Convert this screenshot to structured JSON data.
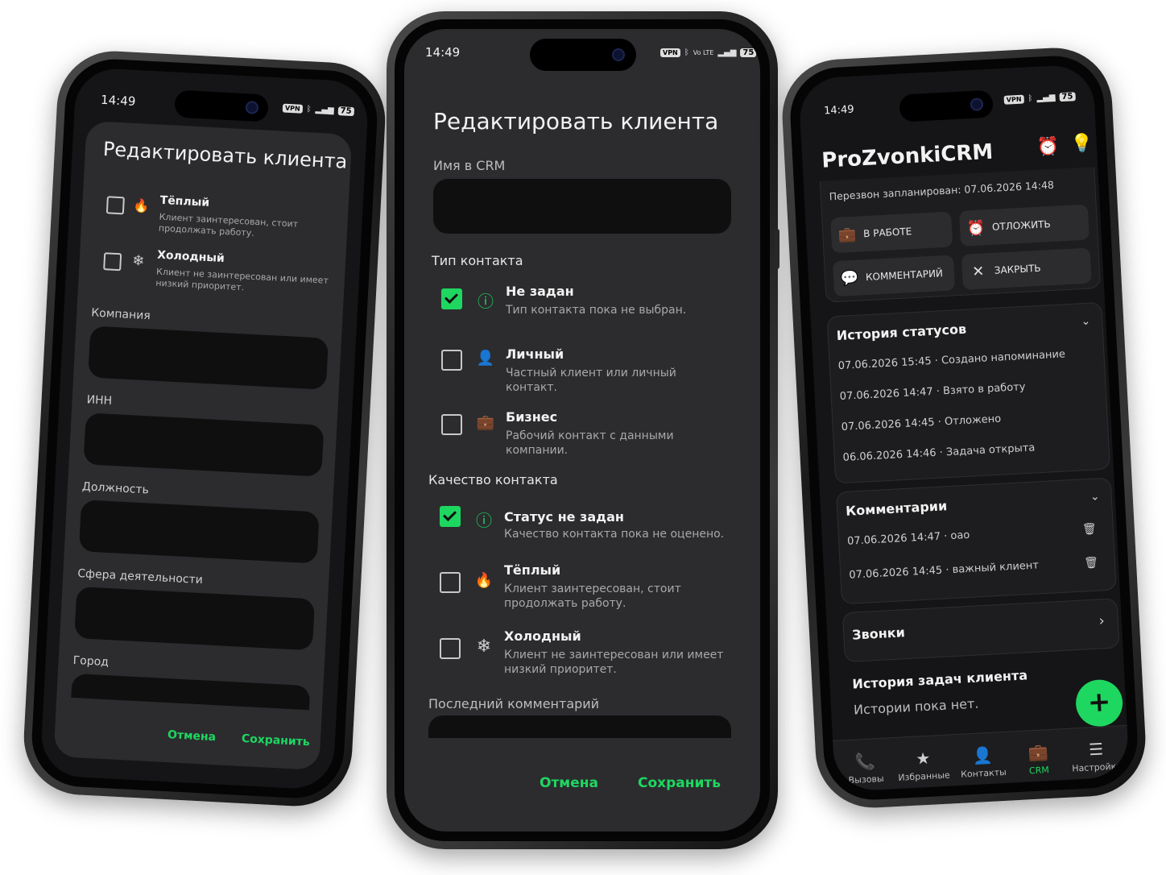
{
  "status_bar": {
    "time": "14:49",
    "vpn": "VPN",
    "volte": "Vo LTE",
    "battery": "75"
  },
  "left": {
    "title": "Редактировать клиента",
    "options": [
      {
        "label": "Тёплый",
        "desc": "Клиент заинтересован, стоит продолжать работу.",
        "icon": "flame-icon",
        "glyph": "🔥",
        "checked": false
      },
      {
        "label": "Холодный",
        "desc": "Клиент не заинтересован или имеет низкий приоритет.",
        "icon": "snowflake-icon",
        "glyph": "❄",
        "checked": false
      }
    ],
    "fields": [
      "Компания",
      "ИНН",
      "Должность",
      "Сфера деятельности",
      "Город"
    ],
    "cancel": "Отмена",
    "save": "Сохранить"
  },
  "center": {
    "title": "Редактировать клиента",
    "name_label": "Имя в CRM",
    "contact_type_label": "Тип контакта",
    "contact_types": [
      {
        "label": "Не задан",
        "desc": "Тип контакта пока не выбран.",
        "icon": "info-icon",
        "glyph": "ⓘ",
        "checked": true
      },
      {
        "label": "Личный",
        "desc": "Частный клиент или личный контакт.",
        "icon": "person-icon",
        "glyph": "👤",
        "checked": false
      },
      {
        "label": "Бизнес",
        "desc": "Рабочий контакт с данными компании.",
        "icon": "briefcase-icon",
        "glyph": "💼",
        "checked": false
      }
    ],
    "quality_label": "Качество контакта",
    "qualities": [
      {
        "label": "Статус не задан",
        "desc": "Качество контакта пока не оценено.",
        "icon": "info-icon",
        "glyph": "ⓘ",
        "checked": true
      },
      {
        "label": "Тёплый",
        "desc": "Клиент заинтересован, стоит продолжать работу.",
        "icon": "flame-icon",
        "glyph": "🔥",
        "checked": false
      },
      {
        "label": "Холодный",
        "desc": "Клиент не заинтересован или имеет низкий приоритет.",
        "icon": "snowflake-icon",
        "glyph": "❄",
        "checked": false
      }
    ],
    "last_comment_label": "Последний комментарий",
    "cancel": "Отмена",
    "save": "Сохранить"
  },
  "right": {
    "app_title": "ProZvonkiCRM",
    "scheduled": "Перезвон запланирован: 07.06.2026 14:48",
    "actions": [
      {
        "label": "В РАБОТЕ",
        "icon": "briefcase-icon",
        "glyph": "💼"
      },
      {
        "label": "ОТЛОЖИТЬ",
        "icon": "alarm-icon",
        "glyph": "⏰"
      },
      {
        "label": "КОММЕНТАРИЙ",
        "icon": "comment-icon",
        "glyph": "💬"
      },
      {
        "label": "ЗАКРЫТЬ",
        "icon": "close-icon",
        "glyph": "✕"
      }
    ],
    "status_history": {
      "title": "История статусов",
      "items": [
        "07.06.2026 15:45 · Создано напоминание",
        "07.06.2026 14:47 · Взято в работу",
        "07.06.2026 14:45 · Отложено",
        "06.06.2026 14:46 · Задача открыта"
      ]
    },
    "comments": {
      "title": "Комментарии",
      "items": [
        "07.06.2026 14:47 · оао",
        "07.06.2026 14:45 · важный клиент"
      ]
    },
    "calls_title": "Звонки",
    "task_history_title": "История задач клиента",
    "task_history_empty": "Истории пока нет.",
    "nav": [
      {
        "label": "Вызовы",
        "glyph": "📞",
        "icon": "phone-icon",
        "active": false
      },
      {
        "label": "Избранные",
        "glyph": "★",
        "icon": "star-icon",
        "active": false
      },
      {
        "label": "Контакты",
        "glyph": "👤",
        "icon": "person-icon",
        "active": false
      },
      {
        "label": "CRM",
        "glyph": "💼",
        "icon": "briefcase-icon",
        "active": true
      },
      {
        "label": "Настройки",
        "glyph": "☰",
        "icon": "settings-icon",
        "active": false
      }
    ],
    "accent": "#1ed760"
  }
}
